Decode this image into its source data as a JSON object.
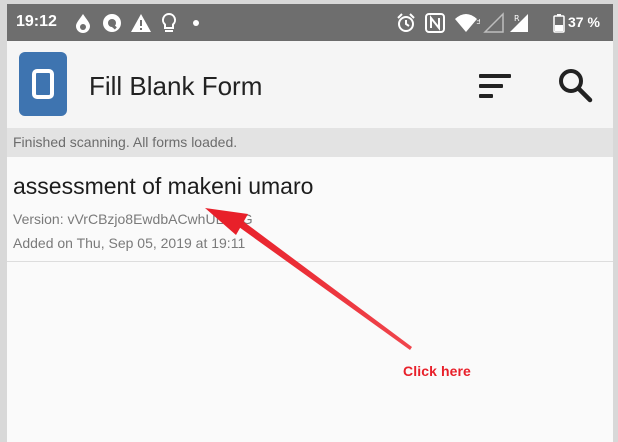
{
  "status_bar": {
    "time": "19:12",
    "battery_text": "37 %",
    "icons": [
      "drop-icon",
      "circle-q-icon",
      "warning-icon",
      "lightbulb-icon",
      "dot-icon",
      "alarm-icon",
      "nfc-icon",
      "wifi-icon",
      "signal-icon",
      "signal-roaming-icon",
      "battery-icon"
    ]
  },
  "app_bar": {
    "title": "Fill Blank Form",
    "logo_icon": "odk-collect-logo",
    "actions": [
      "sort-icon",
      "search-icon"
    ]
  },
  "scan_status": "Finished scanning. All forms loaded.",
  "forms": [
    {
      "name": "assessment of makeni umaro",
      "version": "Version: vVrCBzjo8EwdbACwhULVwG",
      "added": "Added on Thu, Sep 05, 2019 at 19:11"
    }
  ],
  "annotation": {
    "label": "Click here",
    "color": "#e8202a"
  },
  "colors": {
    "status_bar": "#6e6e6e",
    "app_bar": "#f5f5f5",
    "logo": "#3e74b0",
    "scan_status_bg": "#e3e3e3"
  }
}
